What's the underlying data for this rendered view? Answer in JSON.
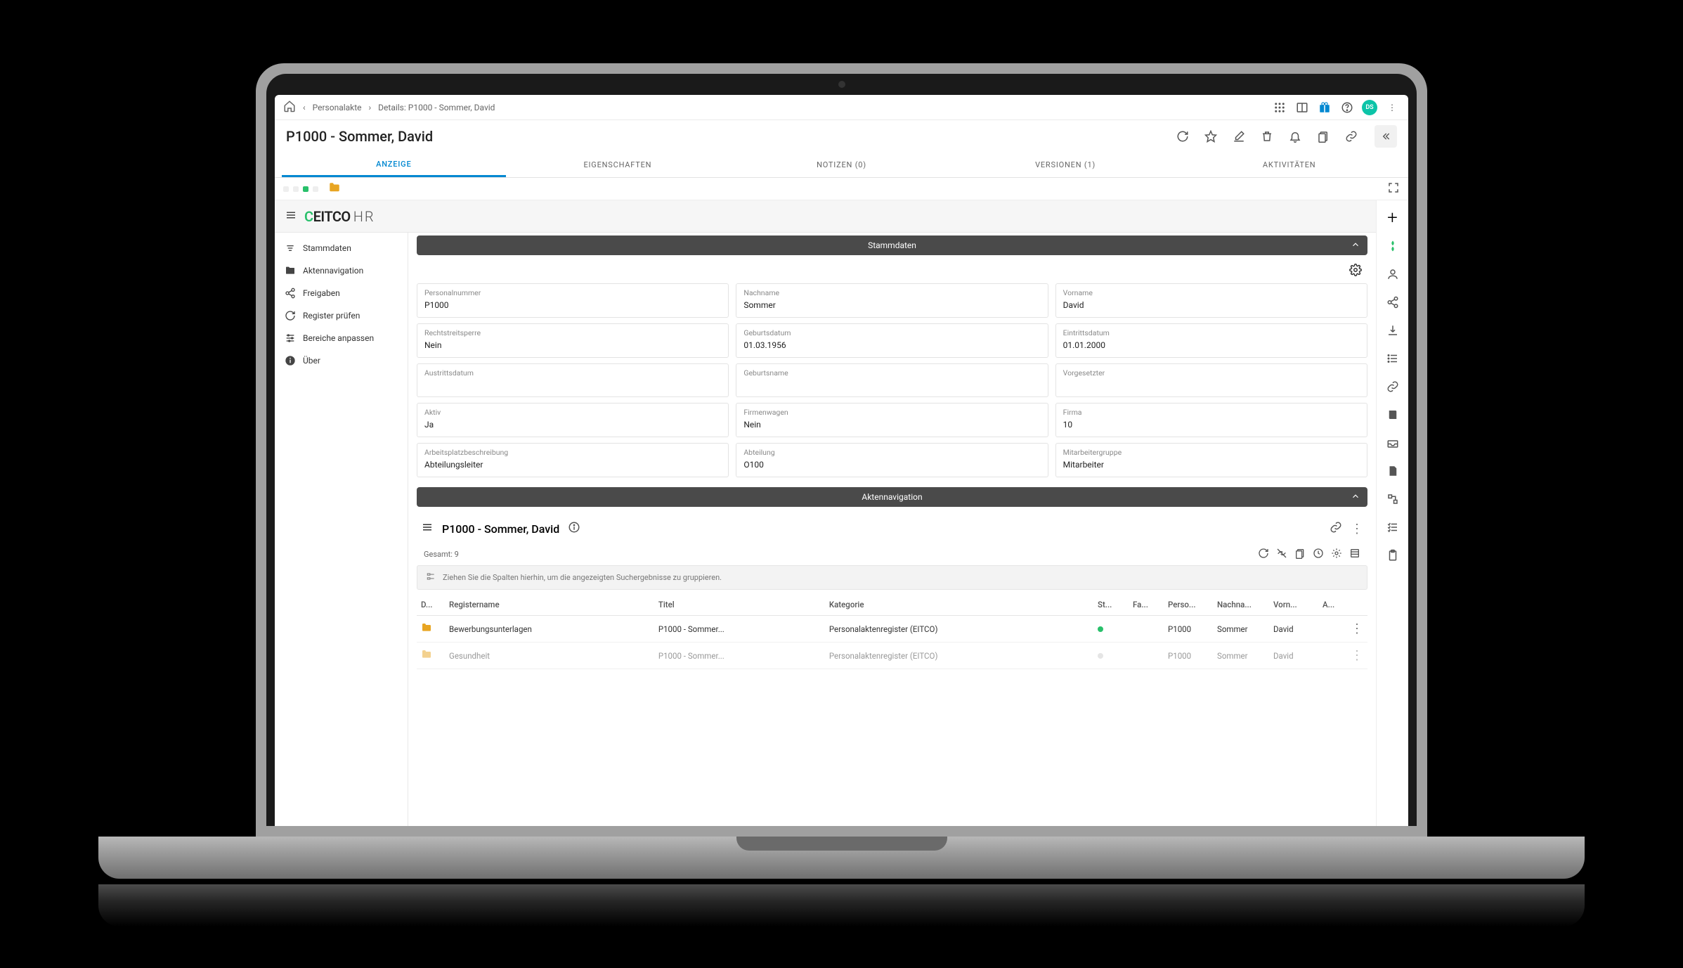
{
  "breadcrumb": {
    "item1": "Personalakte",
    "item2": "Details: P1000 - Sommer, David"
  },
  "user_badge": "DS",
  "page_title": "P1000 - Sommer, David",
  "tabs": {
    "t0": "Anzeige",
    "t1": "Eigenschaften",
    "t2": "Notizen (0)",
    "t3": "Versionen (1)",
    "t4": "Aktivitäten"
  },
  "brand": {
    "name": "EITCO",
    "suffix": "HR"
  },
  "sidenav": {
    "i0": "Stammdaten",
    "i1": "Aktennavigation",
    "i2": "Freigaben",
    "i3": "Register prüfen",
    "i4": "Bereiche anpassen",
    "i5": "Über"
  },
  "sections": {
    "stammdaten_title": "Stammdaten",
    "aktennav_title": "Aktennavigation"
  },
  "fields": {
    "personalnummer_l": "Personalnummer",
    "personalnummer_v": "P1000",
    "nachname_l": "Nachname",
    "nachname_v": "Sommer",
    "vorname_l": "Vorname",
    "vorname_v": "David",
    "rechtstreit_l": "Rechtstreitsperre",
    "rechtstreit_v": "Nein",
    "geburtsdatum_l": "Geburtsdatum",
    "geburtsdatum_v": "01.03.1956",
    "eintritt_l": "Eintrittsdatum",
    "eintritt_v": "01.01.2000",
    "austritt_l": "Austrittsdatum",
    "austritt_v": "",
    "geburtsname_l": "Geburtsname",
    "geburtsname_v": "",
    "vorgesetzter_l": "Vorgesetzter",
    "vorgesetzter_v": "",
    "aktiv_l": "Aktiv",
    "aktiv_v": "Ja",
    "firmenwagen_l": "Firmenwagen",
    "firmenwagen_v": "Nein",
    "firma_l": "Firma",
    "firma_v": "10",
    "arbeitsplatz_l": "Arbeitsplatzbeschreibung",
    "arbeitsplatz_v": "Abteilungsleiter",
    "abteilung_l": "Abteilung",
    "abteilung_v": "O100",
    "mitarbeitergruppe_l": "Mitarbeitergruppe",
    "mitarbeitergruppe_v": "Mitarbeiter"
  },
  "aktennav": {
    "title": "P1000 - Sommer, David",
    "total_label": "Gesamt: 9",
    "group_hint": "Ziehen Sie die Spalten hierhin, um die angezeigten Suchergebnisse zu gruppieren."
  },
  "columns": {
    "c0": "D...",
    "c1": "Registername",
    "c2": "Titel",
    "c3": "Kategorie",
    "c4": "St...",
    "c5": "Fa...",
    "c6": "Perso...",
    "c7": "Nachna...",
    "c8": "Vorn...",
    "c9": "A..."
  },
  "rows": [
    {
      "registername": "Bewerbungsunterlagen",
      "titel": "P1000 - Sommer...",
      "kategorie": "Personalaktenregister (EITCO)",
      "pers": "P1000",
      "nach": "Sommer",
      "vor": "David"
    },
    {
      "registername": "Gesundheit",
      "titel": "P1000 - Sommer...",
      "kategorie": "Personalaktenregister (EITCO)",
      "pers": "P1000",
      "nach": "Sommer",
      "vor": "David"
    }
  ]
}
